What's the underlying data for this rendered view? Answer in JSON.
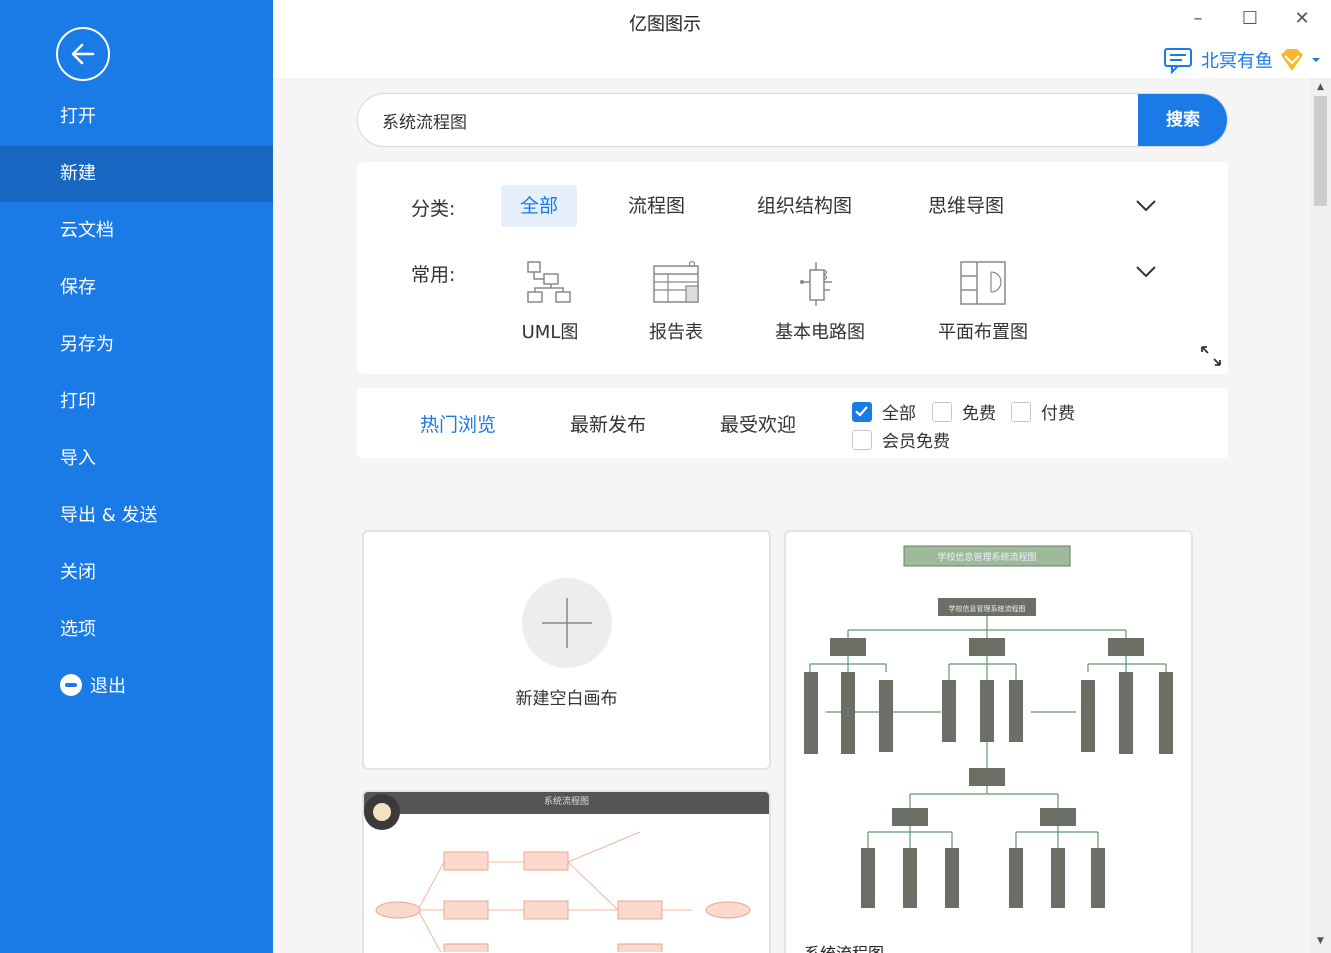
{
  "app_title": "亿图图示",
  "window_controls": {
    "minimize": "–",
    "maximize": "☐",
    "close": "✕"
  },
  "user": {
    "name": "北冥有鱼",
    "icon": "message-icon",
    "badge": "vip-diamond-icon"
  },
  "sidebar": {
    "items": [
      {
        "label": "打开"
      },
      {
        "label": "新建"
      },
      {
        "label": "云文档"
      },
      {
        "label": "保存"
      },
      {
        "label": "另存为"
      },
      {
        "label": "打印"
      },
      {
        "label": "导入"
      },
      {
        "label": "导出 & 发送"
      },
      {
        "label": "关闭"
      },
      {
        "label": "选项"
      },
      {
        "label": "退出"
      }
    ],
    "active": "新建"
  },
  "search": {
    "value": "系统流程图",
    "button": "搜索"
  },
  "filter": {
    "category_label": "分类:",
    "categories": [
      {
        "label": "全部"
      },
      {
        "label": "流程图"
      },
      {
        "label": "组织结构图"
      },
      {
        "label": "思维导图"
      }
    ],
    "common_label": "常用:",
    "common": [
      {
        "label": "UML图",
        "icon": "uml-icon"
      },
      {
        "label": "报告表",
        "icon": "report-table-icon"
      },
      {
        "label": "基本电路图",
        "icon": "circuit-icon"
      },
      {
        "label": "平面布置图",
        "icon": "floor-plan-icon"
      }
    ]
  },
  "sort": {
    "tabs": [
      {
        "label": "热门浏览"
      },
      {
        "label": "最新发布"
      },
      {
        "label": "最受欢迎"
      }
    ],
    "checks": [
      {
        "label": "全部",
        "checked": true
      },
      {
        "label": "免费",
        "checked": false
      },
      {
        "label": "付费",
        "checked": false
      },
      {
        "label": "会员免费",
        "checked": false
      }
    ]
  },
  "cards": {
    "new_blank": "新建空白画布",
    "template1": {
      "name": "系统流程图",
      "preview_title": "学校信息管理系统流程图",
      "root": "学校信息管理系统流程图"
    },
    "template2": {
      "preview_title": "系统流程图"
    }
  }
}
